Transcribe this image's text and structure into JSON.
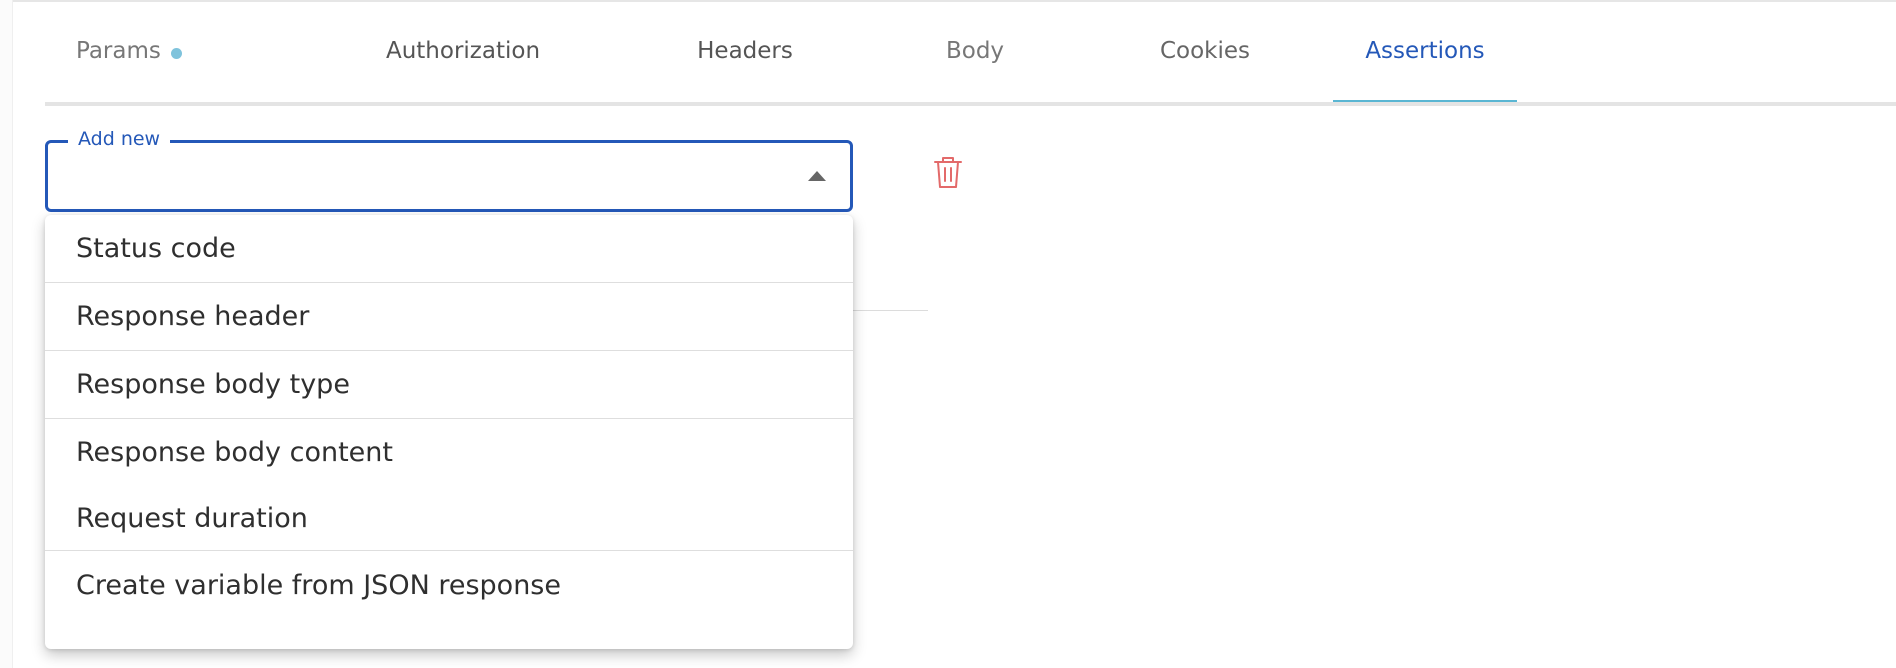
{
  "tabs": [
    {
      "label": "Params",
      "has_dot": true
    },
    {
      "label": "Authorization"
    },
    {
      "label": "Headers"
    },
    {
      "label": "Body"
    },
    {
      "label": "Cookies"
    },
    {
      "label": "Assertions",
      "active": true
    }
  ],
  "add_new": {
    "label": "Add new",
    "value": ""
  },
  "menu": {
    "items": [
      "Status code",
      "Response header",
      "Response body type",
      "Response body content",
      "Request duration",
      "Create variable from JSON response"
    ]
  },
  "colors": {
    "accent": "#2458b8",
    "active_tab_underline": "#5ab6d3",
    "delete": "#e36a6a",
    "dot": "#7fc3dc"
  },
  "icons": {
    "delete": "trash-icon",
    "dropdown": "caret-up-icon"
  }
}
